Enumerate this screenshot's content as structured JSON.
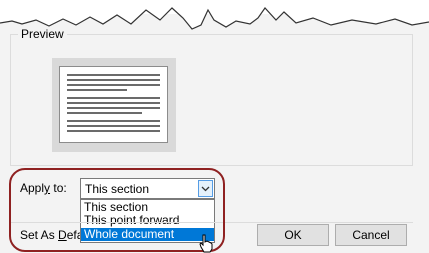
{
  "preview": {
    "legend": "Preview"
  },
  "apply": {
    "label_pre": "Appl",
    "label_accel": "y",
    "label_post": " to:",
    "selected": "This section",
    "options": [
      "This section",
      "This point forward",
      "Whole document"
    ],
    "highlighted_option": "Whole document"
  },
  "footer": {
    "set_default_pre": "Set As ",
    "set_default_accel": "D",
    "set_default_post": "efault",
    "ok": "OK",
    "cancel": "Cancel"
  },
  "colors": {
    "selection": "#0078d7",
    "callout": "#8f2121",
    "dialog_bg": "#f3f3f3"
  }
}
